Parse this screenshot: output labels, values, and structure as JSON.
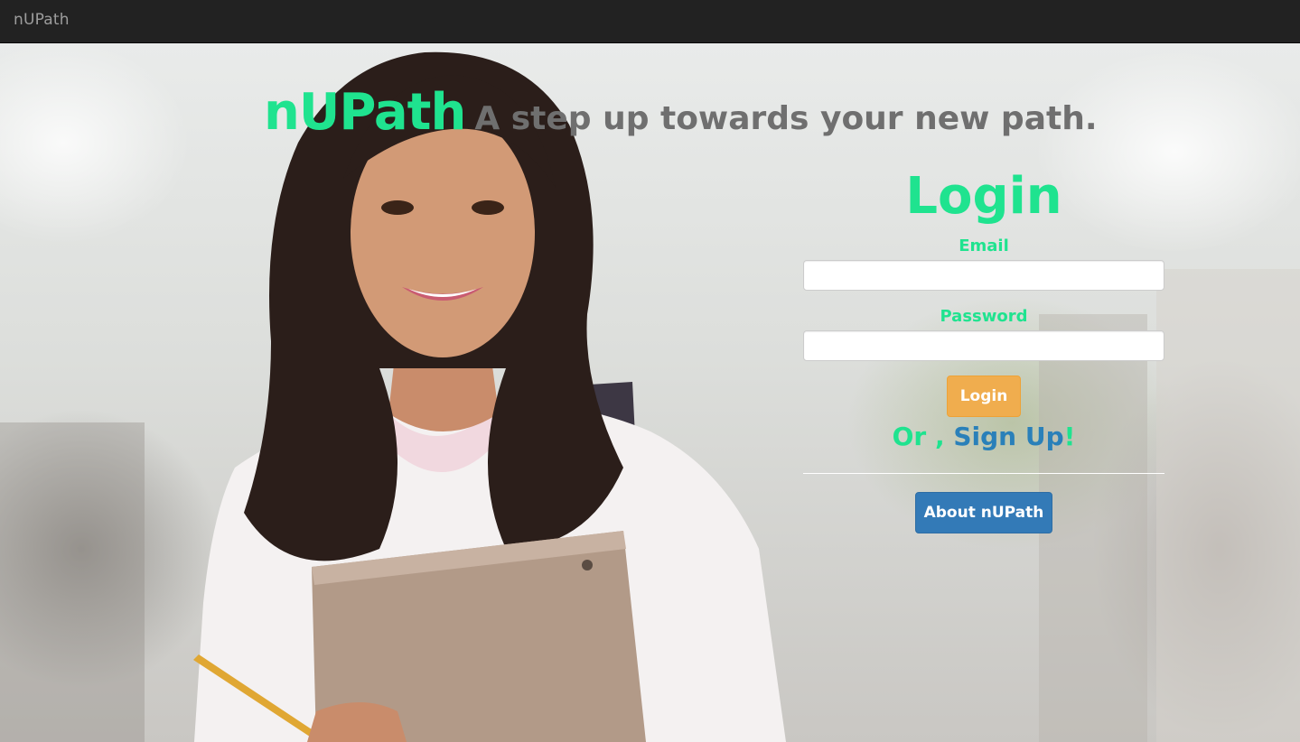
{
  "navbar": {
    "brand": "nUPath"
  },
  "hero": {
    "image": "photo-student-with-notebook",
    "tagline_brand": "nUPath",
    "tagline_text": "A step up towards your new path."
  },
  "login": {
    "title": "Login",
    "email_label": "Email",
    "email_value": "",
    "password_label": "Password",
    "password_value": "",
    "submit_label": "Login",
    "or_text": "Or ,",
    "signup_link": "Sign Up",
    "signup_suffix": "!",
    "about_label": "About nUPath"
  },
  "colors": {
    "accent_green": "#1fe38f",
    "navbar_bg": "#222222",
    "warning_orange": "#f0ad4e",
    "primary_blue": "#337ab7",
    "link_blue": "#2a80b9"
  }
}
